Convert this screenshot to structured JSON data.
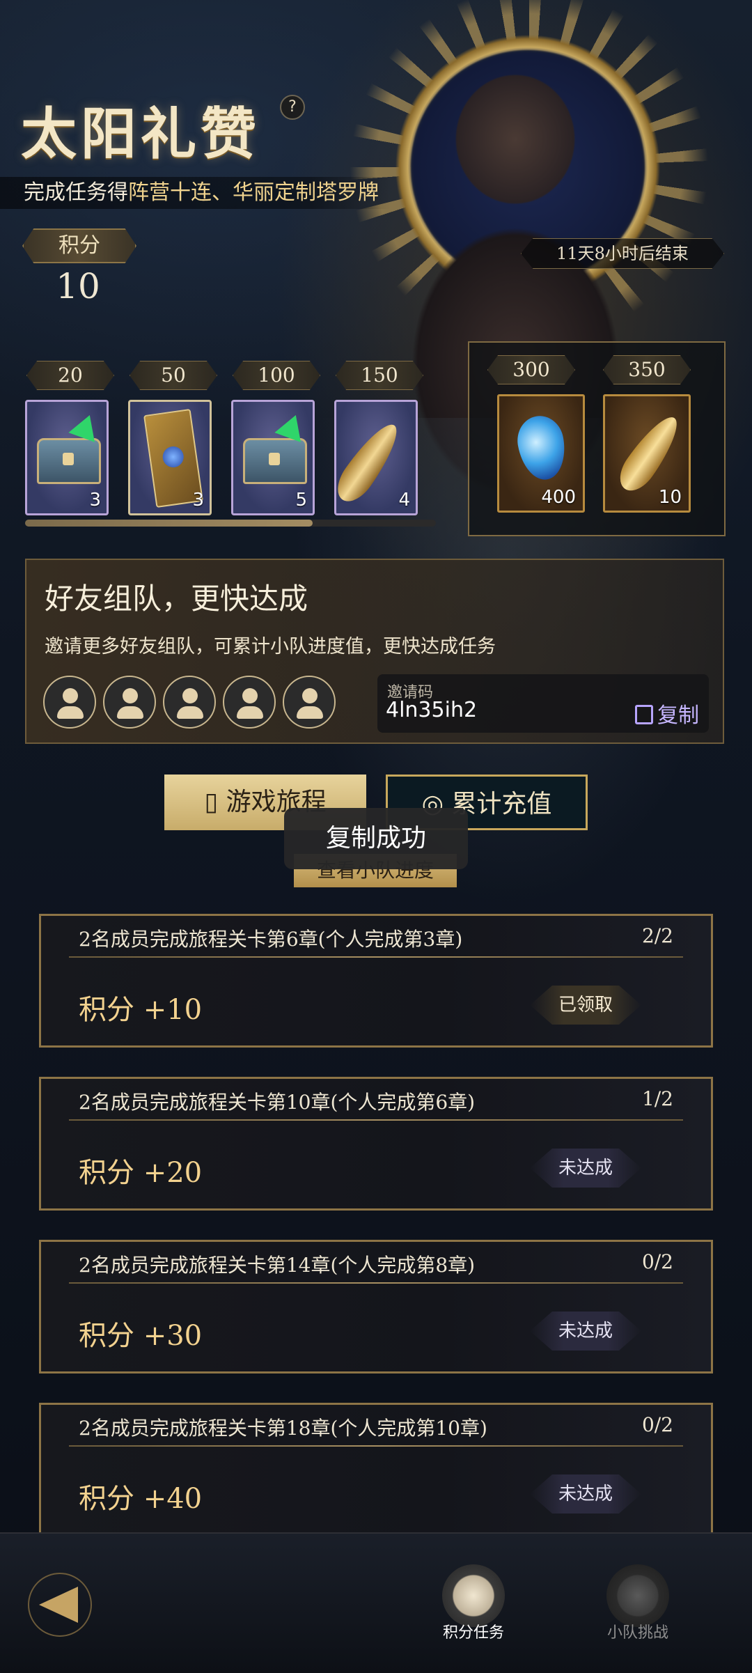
{
  "header": {
    "title": "太阳礼赞",
    "help_icon": "?",
    "subtitle_prefix": "完成任务得",
    "subtitle_highlight": "阵营十连、华丽定制塔罗牌",
    "score_label": "积分",
    "score_value": "10",
    "timer": "11天8小时后结束"
  },
  "milestones": [
    {
      "points": "20",
      "item": "chest-icon",
      "count": "3"
    },
    {
      "points": "50",
      "item": "tarot-card-icon",
      "count": "3"
    },
    {
      "points": "100",
      "item": "chest-icon",
      "count": "5"
    },
    {
      "points": "150",
      "item": "feather-icon",
      "count": "4"
    }
  ],
  "grand_rewards": [
    {
      "points": "300",
      "item": "crystal-icon",
      "count": "400"
    },
    {
      "points": "350",
      "item": "golden-feather-icon",
      "count": "10"
    }
  ],
  "team": {
    "title": "好友组队，更快达成",
    "desc": "邀请更多好友组队，可累计小队进度值，更快达成任务",
    "invite_label": "邀请码",
    "invite_code": "4ln35ih2",
    "copy_label": "复制"
  },
  "tabs": {
    "game_journey": "游戏旅程",
    "recharge": "累计充值",
    "view_team_progress": "查看小队进度"
  },
  "toast": "复制成功",
  "tasks": [
    {
      "condition": "2名成员完成旅程关卡第6章(个人完成第3章)",
      "progress": "2/2",
      "reward": "积分 +10",
      "status": "已领取"
    },
    {
      "condition": "2名成员完成旅程关卡第10章(个人完成第6章)",
      "progress": "1/2",
      "reward": "积分 +20",
      "status": "未达成"
    },
    {
      "condition": "2名成员完成旅程关卡第14章(个人完成第8章)",
      "progress": "0/2",
      "reward": "积分 +30",
      "status": "未达成"
    },
    {
      "condition": "2名成员完成旅程关卡第18章(个人完成第10章)",
      "progress": "0/2",
      "reward": "积分 +40",
      "status": "未达成"
    }
  ],
  "bottom_nav": {
    "points_tasks": "积分任务",
    "team_challenge": "小队挑战"
  },
  "colors": {
    "accent_gold": "#d7b46a",
    "copy_purple": "#c6b6ff"
  }
}
